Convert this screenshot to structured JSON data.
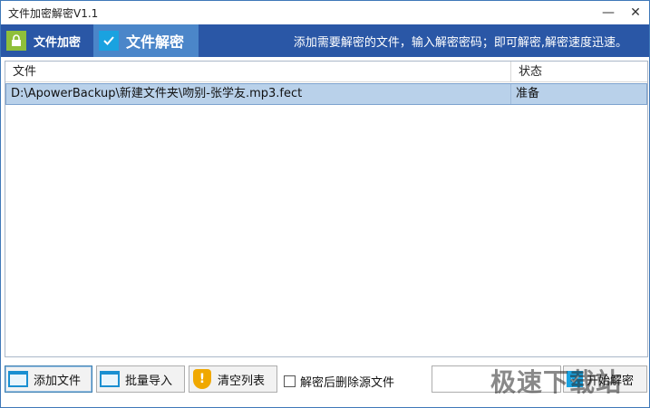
{
  "window": {
    "title": "文件加密解密V1.1",
    "minimize_glyph": "—",
    "close_glyph": "✕"
  },
  "tabs": [
    {
      "label": "文件加密",
      "icon": "lock-icon",
      "active": false,
      "icon_color": "#8fbf3a"
    },
    {
      "label": "文件解密",
      "icon": "checkmark-icon",
      "active": true,
      "icon_color": "#1aa2e0"
    }
  ],
  "hint": "添加需要解密的文件，输入解密密码；即可解密,解密速度迅速。",
  "list": {
    "columns": [
      "文件",
      "状态"
    ],
    "rows": [
      {
        "file": "D:\\ApowerBackup\\新建文件夹\\吻别-张学友.mp3.fect",
        "status": "准备"
      }
    ]
  },
  "toolbar": {
    "add_label": "添加文件",
    "batch_label": "批量导入",
    "clear_label": "清空列表",
    "delete_source_label": "解密后删除源文件",
    "delete_source_checked": false,
    "password_value": "",
    "start_label": "开始解密"
  },
  "watermark": "极速下载站",
  "colors": {
    "accent": "#2a57a6",
    "active_tab": "#4b86c9",
    "selection": "#b9d1ea"
  }
}
